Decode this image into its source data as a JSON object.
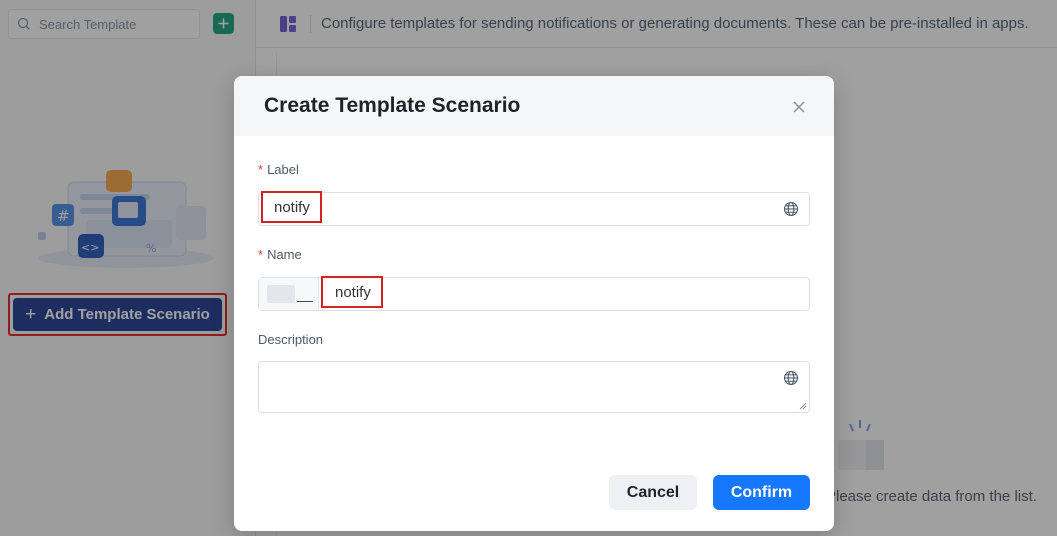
{
  "sidebar": {
    "search_placeholder": "Search Template",
    "add_scenario_label": "Add Template Scenario"
  },
  "topbar": {
    "description": "Configure templates for sending notifications or generating documents. These can be pre-installed in apps."
  },
  "main": {
    "empty_text": "Please create data from the list."
  },
  "modal": {
    "title": "Create Template Scenario",
    "label_field": {
      "label": "Label",
      "required_mark": "*",
      "value": "notify"
    },
    "name_field": {
      "label": "Name",
      "required_mark": "*",
      "prefix_separator": "__",
      "value": "notify"
    },
    "description_field": {
      "label": "Description",
      "value": ""
    },
    "cancel_label": "Cancel",
    "confirm_label": "Confirm"
  },
  "colors": {
    "primary": "#1677ff",
    "add_button": "#1e3a8f",
    "highlight": "#d52222",
    "required": "#e53935"
  },
  "icons": [
    "search-icon",
    "plus-icon",
    "layout-grid-icon",
    "close-icon",
    "globe-icon",
    "empty-box-icon"
  ]
}
